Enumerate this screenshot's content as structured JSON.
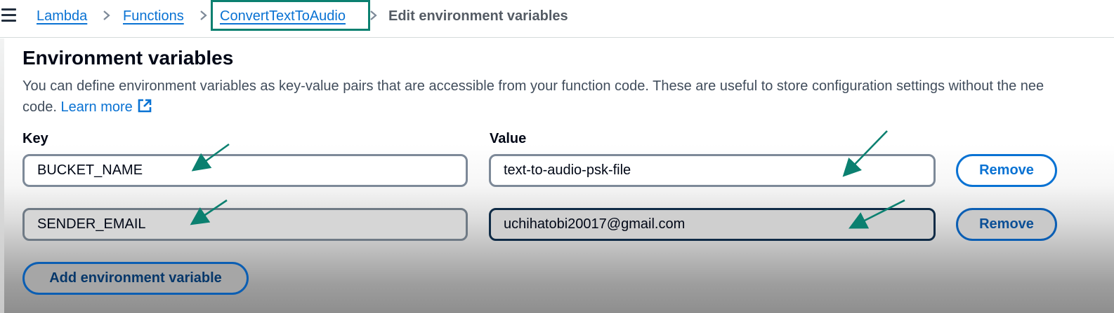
{
  "breadcrumb": {
    "items": [
      "Lambda",
      "Functions",
      "ConvertTextToAudio"
    ],
    "current": "Edit environment variables"
  },
  "section": {
    "title": "Environment variables",
    "description_line1": "You can define environment variables as key-value pairs that are accessible from your function code. These are useful to store configuration settings without the nee",
    "description_line2": "code.",
    "learn_more": "Learn more"
  },
  "labels": {
    "key": "Key",
    "value": "Value"
  },
  "variables": [
    {
      "key": "BUCKET_NAME",
      "value": "text-to-audio-psk-file",
      "remove_label": "Remove"
    },
    {
      "key": "SENDER_EMAIL",
      "value": "uchihatobi20017@gmail.com",
      "remove_label": "Remove"
    }
  ],
  "actions": {
    "add_label": "Add environment variable"
  },
  "colors": {
    "link": "#0972d3",
    "annotation": "#0b8070",
    "heading": "#000716"
  },
  "icons": [
    "menu-icon",
    "chevron-right-icon",
    "external-link-icon",
    "arrow-annotation"
  ]
}
